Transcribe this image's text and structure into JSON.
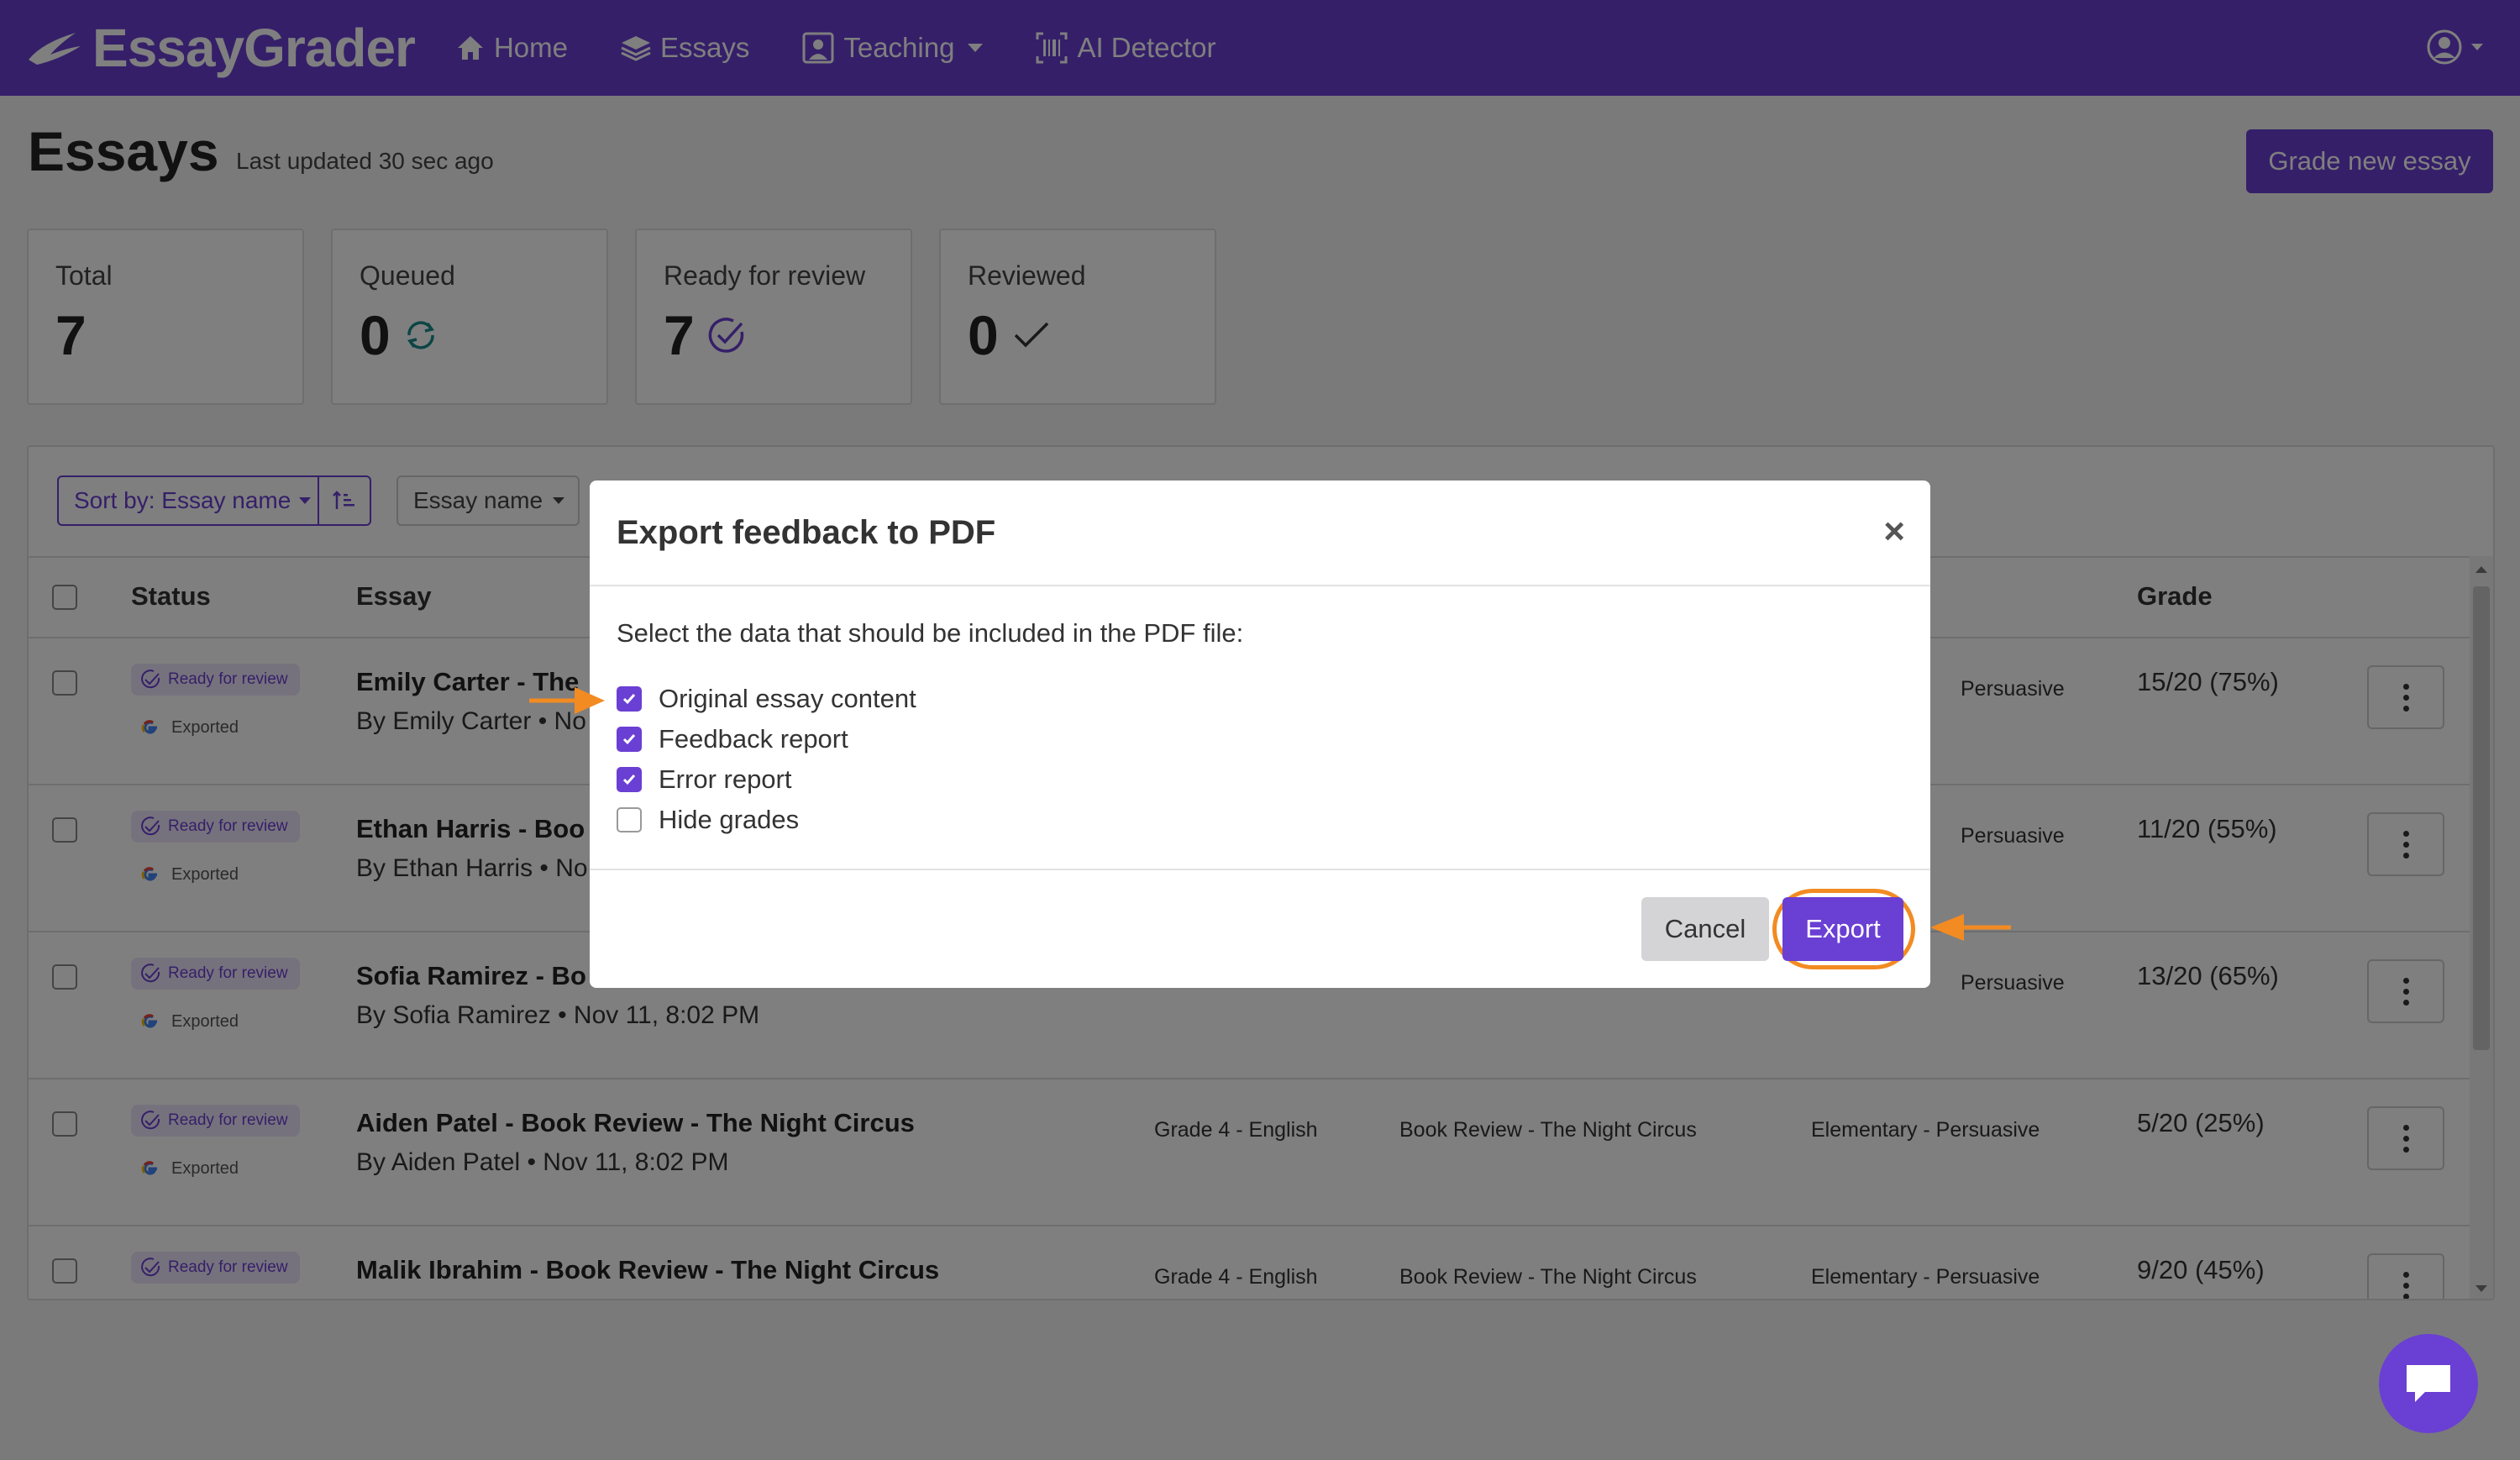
{
  "nav": {
    "brand": "EssayGrader",
    "items": [
      {
        "label": "Home",
        "icon": "home-icon"
      },
      {
        "label": "Essays",
        "icon": "layers-icon"
      },
      {
        "label": "Teaching",
        "icon": "teacher-icon",
        "has_dropdown": true
      },
      {
        "label": "AI Detector",
        "icon": "barcode-icon"
      }
    ],
    "user_icon": "user-circle-icon"
  },
  "page": {
    "title": "Essays",
    "last_updated": "Last updated 30 sec ago",
    "grade_button": "Grade new essay"
  },
  "stats": [
    {
      "label": "Total",
      "value": "7",
      "icon": ""
    },
    {
      "label": "Queued",
      "value": "0",
      "icon": "refresh-icon"
    },
    {
      "label": "Ready for review",
      "value": "7",
      "icon": "check-circle-icon"
    },
    {
      "label": "Reviewed",
      "value": "0",
      "icon": "check-icon"
    }
  ],
  "toolbar": {
    "sort_label": "Sort by: Essay name",
    "filter_label": "Essay name"
  },
  "table": {
    "headers": {
      "status": "Status",
      "essay": "Essay",
      "grade": "Grade"
    },
    "rows": [
      {
        "status": "Ready for review",
        "exported": "Exported",
        "title": "Emily Carter - The",
        "meta": "By Emily Carter • No",
        "class": "",
        "assignment": "",
        "rubric": "Persuasive",
        "grade": "15/20 (75%)"
      },
      {
        "status": "Ready for review",
        "exported": "Exported",
        "title": "Ethan Harris - Boo",
        "meta": "By Ethan Harris • No",
        "class": "",
        "assignment": "",
        "rubric": "Persuasive",
        "grade": "11/20 (55%)"
      },
      {
        "status": "Ready for review",
        "exported": "Exported",
        "title": "Sofia Ramirez - Bo",
        "meta": "By Sofia Ramirez • Nov 11, 8:02 PM",
        "class": "",
        "assignment": "",
        "rubric": "Persuasive",
        "grade": "13/20 (65%)"
      },
      {
        "status": "Ready for review",
        "exported": "Exported",
        "title": "Aiden Patel - Book Review - The Night Circus",
        "meta": "By Aiden Patel • Nov 11, 8:02 PM",
        "class": "Grade 4 - English",
        "assignment": "Book Review - The Night Circus",
        "rubric": "Elementary - Persuasive",
        "grade": "5/20 (25%)"
      },
      {
        "status": "Ready for review",
        "exported": "",
        "title": "Malik Ibrahim - Book Review - The Night Circus",
        "meta": "",
        "class": "Grade 4 - English",
        "assignment": "Book Review - The Night Circus",
        "rubric": "Elementary - Persuasive",
        "grade": "9/20 (45%)"
      }
    ]
  },
  "modal": {
    "title": "Export feedback to PDF",
    "close": "×",
    "description": "Select the data that should be included in the PDF file:",
    "options": [
      {
        "label": "Original essay content",
        "checked": true
      },
      {
        "label": "Feedback report",
        "checked": true
      },
      {
        "label": "Error report",
        "checked": true
      },
      {
        "label": "Hide grades",
        "checked": false
      }
    ],
    "cancel": "Cancel",
    "export": "Export"
  },
  "colors": {
    "brand": "#6a3fd3",
    "annotation": "#f28b22",
    "badge_bg": "#ece5fb"
  }
}
